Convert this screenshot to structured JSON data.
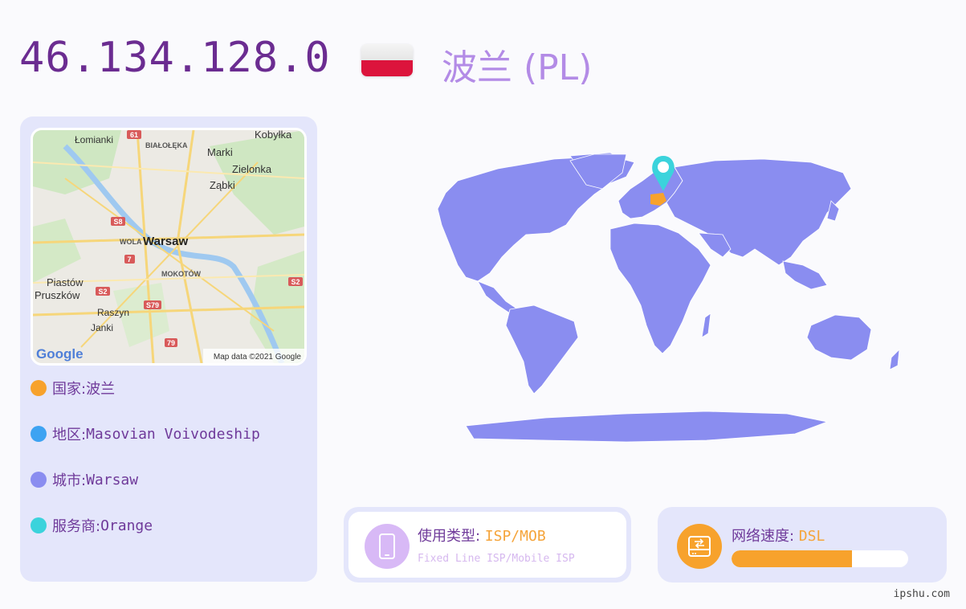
{
  "header": {
    "ip": "46.134.128.0",
    "country_title": "波兰 (PL)"
  },
  "map_thumbnail": {
    "labels": [
      "Łomianki",
      "BIAŁOŁĘKA",
      "Kobyłka",
      "Marki",
      "Zielonka",
      "Ząbki",
      "WOLA",
      "Warsaw",
      "MOKOTÓW",
      "Piastów",
      "Pruszków",
      "Raszyn",
      "Janki"
    ],
    "road_badges": [
      "61",
      "S8",
      "7",
      "S2",
      "S79",
      "S2",
      "79"
    ],
    "logo": "Google",
    "attribution": "Map data ©2021 Google"
  },
  "info": [
    {
      "label": "国家: ",
      "value": "波兰",
      "color": "#f7a22c"
    },
    {
      "label": "地区: ",
      "value": "Masovian Voivodeship",
      "color": "#3da3f2"
    },
    {
      "label": "城市: ",
      "value": "Warsaw",
      "color": "#8a8df0"
    },
    {
      "label": "服务商: ",
      "value": "Orange",
      "color": "#3bd3dc"
    }
  ],
  "usage": {
    "label": "使用类型: ",
    "value": "ISP/MOB",
    "sub": "Fixed Line ISP/Mobile ISP",
    "icon": "mobile-phone-icon",
    "icon_color": "#d8b9f6"
  },
  "speed": {
    "label": "网络速度: ",
    "value": "DSL",
    "level": 0.68,
    "icon": "network-device-icon",
    "icon_color": "#f7a22c"
  },
  "watermark": "ipshu.com",
  "colors": {
    "land": "#8a8df0",
    "highlight": "#f7a22c",
    "pin": "#3bd3dc"
  }
}
